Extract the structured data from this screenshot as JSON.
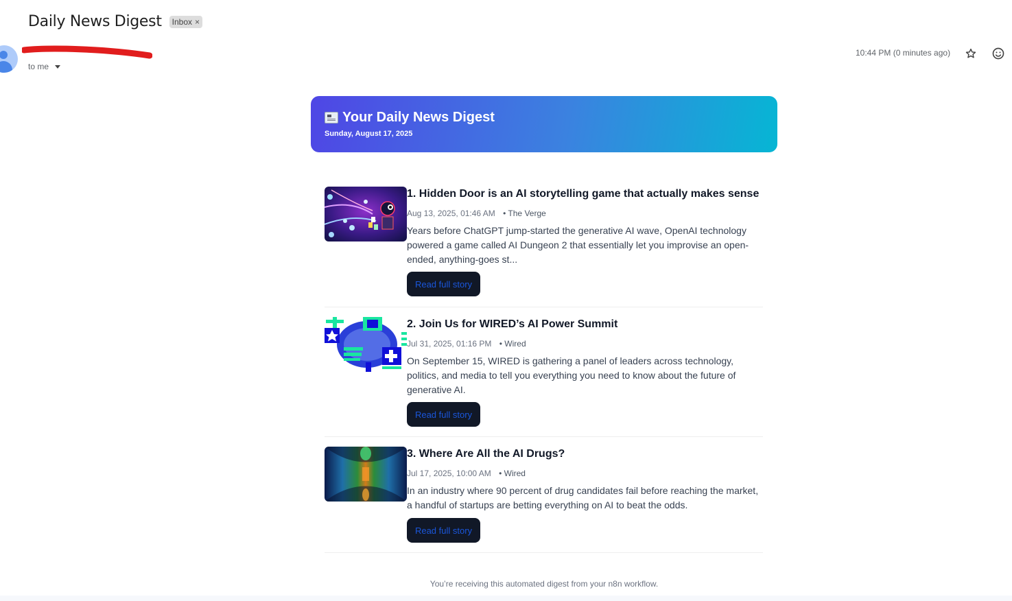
{
  "email": {
    "subject": "Daily News Digest",
    "label_chip": "Inbox",
    "recipient": "to me",
    "timestamp": "10:44 PM (0 minutes ago)"
  },
  "banner": {
    "title": "Your Daily News Digest",
    "date": "Sunday, August 17, 2025",
    "icon": "newspaper-icon"
  },
  "stories": [
    {
      "title": "1. Hidden Door is an AI storytelling game that actually makes sense",
      "date": "Aug 13, 2025, 01:46 AM",
      "source": "• The Verge",
      "description": "Years before ChatGPT jump-started the generative AI wave, OpenAI technology powered a game called AI Dungeon 2 that essentially let you improvise an open-ended, anything-goes st...",
      "button": "Read full story"
    },
    {
      "title": "2. Join Us for WIRED’s AI Power Summit",
      "date": "Jul 31, 2025, 01:16 PM",
      "source": "• Wired",
      "description": "On September 15, WIRED is gathering a panel of leaders across technology, politics, and media to tell you everything you need to know about the future of generative AI.",
      "button": "Read full story"
    },
    {
      "title": "3. Where Are All the AI Drugs?",
      "date": "Jul 17, 2025, 10:00 AM",
      "source": "• Wired",
      "description": "In an industry where 90 percent of drug candidates fail before reaching the market, a handful of startups are betting everything on AI to beat the odds.",
      "button": "Read full story"
    }
  ],
  "footer": "You’re receiving this automated digest from your n8n workflow.",
  "colors": {
    "banner_start": "#4f46e5",
    "banner_end": "#06b6d4",
    "button_bg": "#111827",
    "button_text": "#1a56db",
    "redaction": "#e11d1d"
  }
}
